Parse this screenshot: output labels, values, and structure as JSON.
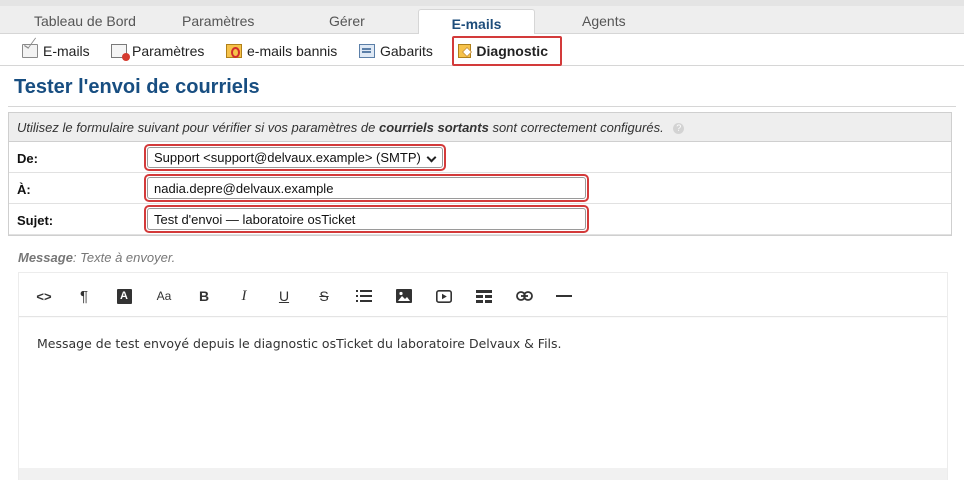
{
  "topnav": {
    "tabs": [
      {
        "label": "Tableau de Bord"
      },
      {
        "label": "Paramètres"
      },
      {
        "label": "Gérer"
      },
      {
        "label": "E-mails",
        "active": true
      },
      {
        "label": "Agents"
      }
    ]
  },
  "subnav": {
    "items": [
      {
        "label": "E-mails",
        "icon": "mail-icon"
      },
      {
        "label": "Paramètres",
        "icon": "mail-settings-icon"
      },
      {
        "label": "e-mails bannis",
        "icon": "banned-mail-icon"
      },
      {
        "label": "Gabarits",
        "icon": "templates-icon"
      },
      {
        "label": "Diagnostic",
        "icon": "diagnostic-icon",
        "active": true
      }
    ]
  },
  "page": {
    "title": "Tester l'envoi de courriels"
  },
  "form": {
    "info_prefix": "Utilisez le formulaire suivant pour vérifier si vos paramètres de",
    "info_bold": "courriels sortants",
    "info_suffix": "sont correctement configurés.",
    "help_glyph": "?",
    "from_label": "De:",
    "from_value": "Support <support@delvaux.example> (SMTP)",
    "to_label": "À:",
    "to_value": "nadia.depre@delvaux.example",
    "subject_label": "Sujet:",
    "subject_value": "Test d'envoi — laboratoire osTicket",
    "message_label": "Message",
    "message_hint": ": Texte à envoyer."
  },
  "editor": {
    "body": "Message de test envoyé depuis le diagnostic osTicket du laboratoire Delvaux & Fils.",
    "toolbar": {
      "code": "<>",
      "paragraph": "¶",
      "font_color": "A",
      "font_size": "Aa",
      "bold": "B",
      "italic": "I",
      "underline": "U",
      "strike": "S"
    }
  },
  "colors": {
    "title": "#184E81",
    "highlight": "#d33a3a",
    "active_tab": "#1e4d7b"
  }
}
